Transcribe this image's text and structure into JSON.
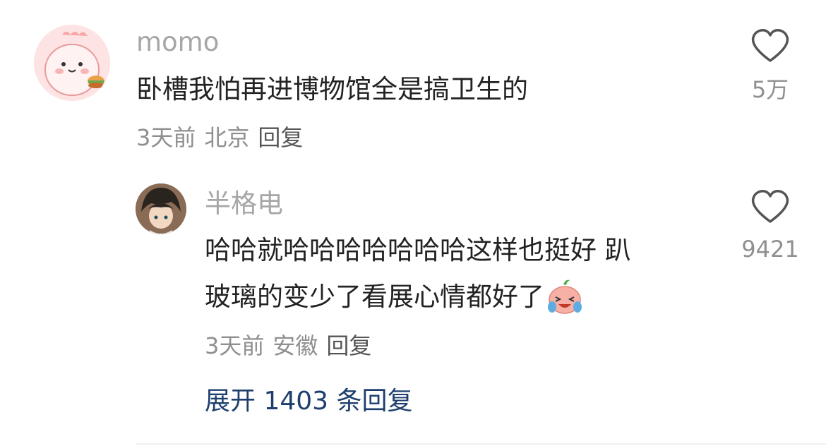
{
  "comments": [
    {
      "username": "momo",
      "text": "卧槽我怕再进博物馆全是搞卫生的",
      "time": "3天前",
      "location": "北京",
      "reply_label": "回复",
      "likes": "5万",
      "avatar_icon": "pink-dinosaur-avatar-icon"
    }
  ],
  "reply": {
    "username": "半格电",
    "text_line1": "哈哈就哈哈哈哈哈哈哈这样也挺好 趴",
    "text_line2": "玻璃的变少了看展心情都好了",
    "emoji": "crying-laughing-face-emoji",
    "time": "3天前",
    "location": "安徽",
    "reply_label": "回复",
    "likes": "9421",
    "avatar_icon": "anime-character-avatar-icon"
  },
  "expand_replies": "展开 1403 条回复",
  "colors": {
    "username": "#a6a6a6",
    "text": "#222222",
    "meta": "#8f8f8f",
    "link": "#1e3f6e"
  }
}
